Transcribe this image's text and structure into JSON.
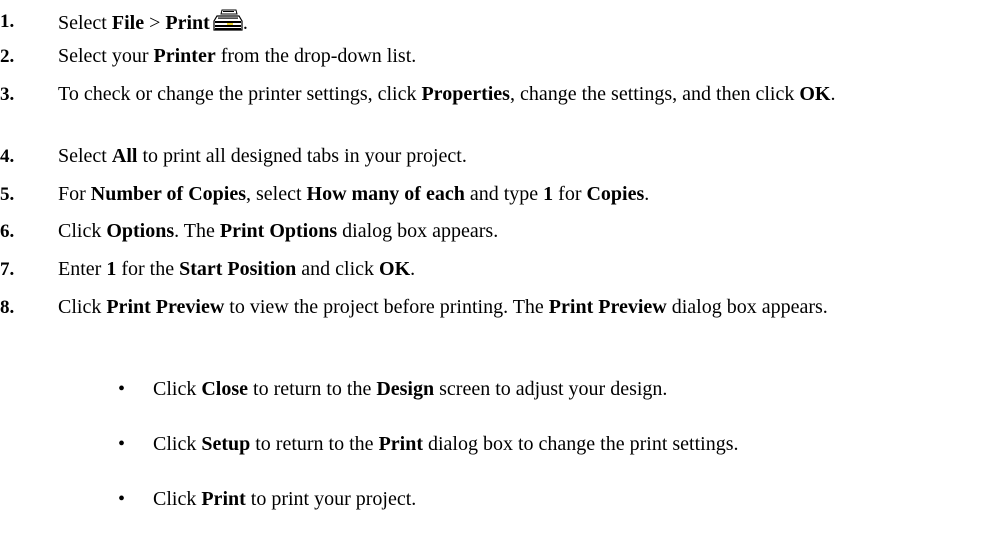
{
  "steps": [
    {
      "num": "1.",
      "parts": [
        [
          "Select ",
          0
        ],
        [
          "File",
          1
        ],
        [
          " > ",
          0
        ],
        [
          "Print",
          1
        ]
      ],
      "after_icon": "."
    },
    {
      "num": "2.",
      "parts": [
        [
          "Select your ",
          0
        ],
        [
          "Printer",
          1
        ],
        [
          " from the drop-down list.",
          0
        ]
      ]
    },
    {
      "num": "3.",
      "parts": [
        [
          "To check or change the printer settings, click ",
          0
        ],
        [
          "Properties",
          1
        ],
        [
          ", change the settings, and then click ",
          0
        ],
        [
          "OK",
          1
        ],
        [
          ".",
          0
        ]
      ]
    },
    {
      "num": "4.",
      "parts": [
        [
          "Select ",
          0
        ],
        [
          "All",
          1
        ],
        [
          " to print all designed tabs in your project.",
          0
        ]
      ]
    },
    {
      "num": "5.",
      "parts": [
        [
          "For ",
          0
        ],
        [
          "Number of Copies",
          1
        ],
        [
          ", select ",
          0
        ],
        [
          "How many of each",
          1
        ],
        [
          " and type ",
          0
        ],
        [
          "1",
          1
        ],
        [
          " for ",
          0
        ],
        [
          "Copies",
          1
        ],
        [
          ".",
          0
        ]
      ]
    },
    {
      "num": "6.",
      "parts": [
        [
          "Click ",
          0
        ],
        [
          "Options",
          1
        ],
        [
          ". The ",
          0
        ],
        [
          "Print Options",
          1
        ],
        [
          " dialog box appears.",
          0
        ]
      ]
    },
    {
      "num": "7.",
      "parts": [
        [
          "Enter ",
          0
        ],
        [
          "1",
          1
        ],
        [
          " for the ",
          0
        ],
        [
          "Start Position",
          1
        ],
        [
          " and click ",
          0
        ],
        [
          "OK",
          1
        ],
        [
          ".",
          0
        ]
      ]
    },
    {
      "num": "8.",
      "parts": [
        [
          "Click ",
          0
        ],
        [
          "Print Preview",
          1
        ],
        [
          " to view the project before printing. The ",
          0
        ],
        [
          "Print Preview",
          1
        ],
        [
          " dialog box appears.",
          0
        ]
      ]
    }
  ],
  "bullets": [
    {
      "symbol": "•",
      "parts": [
        [
          "Click ",
          0
        ],
        [
          "Close",
          1
        ],
        [
          " to return to the ",
          0
        ],
        [
          "Design",
          1
        ],
        [
          " screen to adjust your design.",
          0
        ]
      ]
    },
    {
      "symbol": "•",
      "parts": [
        [
          "Click ",
          0
        ],
        [
          "Setup",
          1
        ],
        [
          " to return to the ",
          0
        ],
        [
          "Print",
          1
        ],
        [
          " dialog box to change the print settings.",
          0
        ]
      ]
    },
    {
      "symbol": "•",
      "parts": [
        [
          "Click ",
          0
        ],
        [
          "Print",
          1
        ],
        [
          " to print your project.",
          0
        ]
      ]
    }
  ],
  "icons": {
    "print": "printer-icon"
  }
}
